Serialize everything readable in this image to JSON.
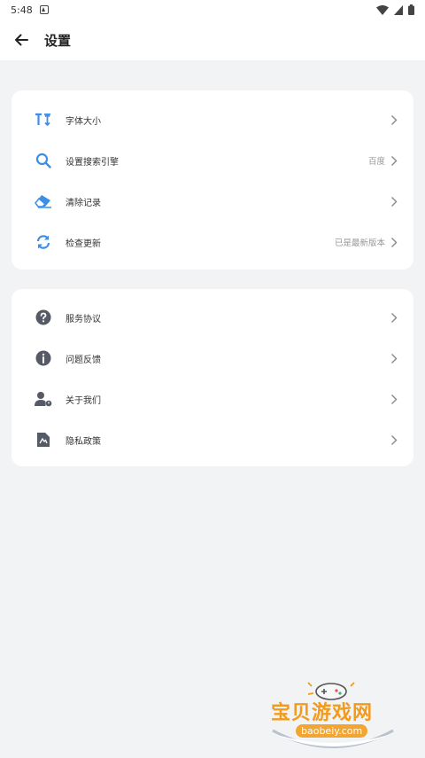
{
  "status_bar": {
    "time": "5:48"
  },
  "header": {
    "title": "设置"
  },
  "card1": {
    "items": [
      {
        "label": "字体大小",
        "value": ""
      },
      {
        "label": "设置搜索引擎",
        "value": "百度"
      },
      {
        "label": "清除记录",
        "value": ""
      },
      {
        "label": "检查更新",
        "value": "已是最新版本"
      }
    ]
  },
  "card2": {
    "items": [
      {
        "label": "服务协议"
      },
      {
        "label": "问题反馈"
      },
      {
        "label": "关于我们"
      },
      {
        "label": "隐私政策"
      }
    ]
  },
  "watermark": {
    "title": "宝贝游戏网",
    "url": "baobeiy.com"
  },
  "colors": {
    "accent": "#3d8ee8",
    "icon_gray": "#555a66",
    "background": "#f2f3f5"
  }
}
